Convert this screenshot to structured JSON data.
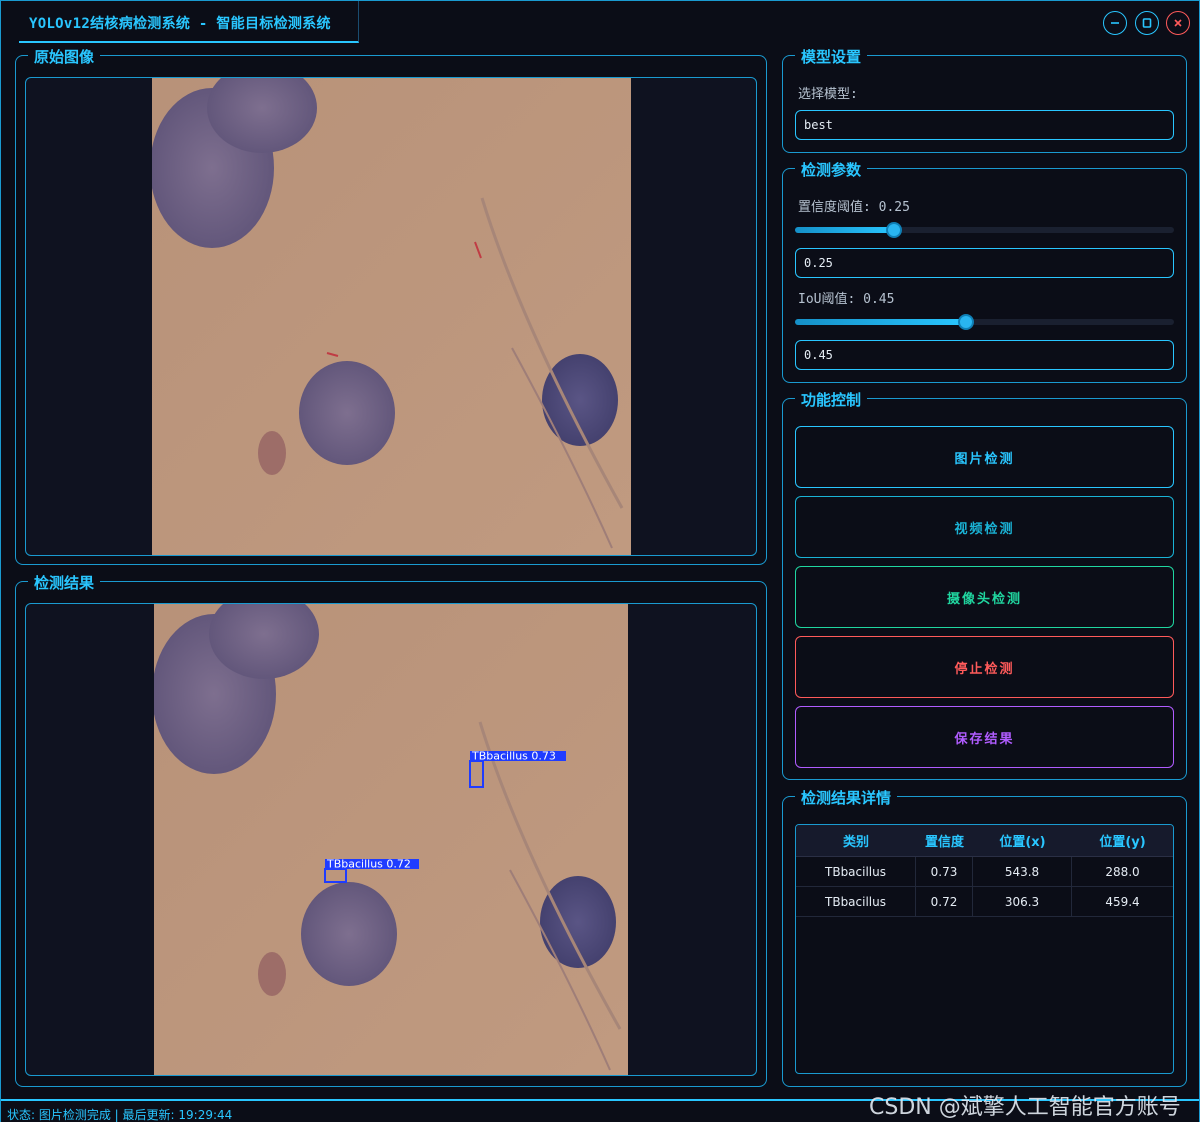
{
  "window": {
    "title": "YOLOv12结核病检测系统 - 智能目标检测系统",
    "minimize_icon": "minimize-icon",
    "maximize_icon": "maximize-icon",
    "close_icon": "close-icon"
  },
  "original_panel": {
    "title": "原始图像"
  },
  "result_panel": {
    "title": "检测结果",
    "detections": [
      {
        "label": "TBbacillus 0.73"
      },
      {
        "label": "TBbacillus 0.72"
      }
    ]
  },
  "model_settings": {
    "title": "模型设置",
    "select_label": "选择模型:",
    "selected_model": "best"
  },
  "detect_params": {
    "title": "检测参数",
    "confidence_label": "置信度阈值: 0.25",
    "confidence_value": "0.25",
    "confidence_level": 0.25,
    "iou_label": "IoU阈值: 0.45",
    "iou_value": "0.45",
    "iou_level": 0.45
  },
  "controls": {
    "title": "功能控制",
    "buttons": [
      {
        "label": "图片检测",
        "color": "#29c6ff"
      },
      {
        "label": "视频检测",
        "color": "#1ab3d6"
      },
      {
        "label": "摄像头检测",
        "color": "#20d6a0"
      },
      {
        "label": "停止检测",
        "color": "#ff5a5a"
      },
      {
        "label": "保存结果",
        "color": "#b05cff"
      }
    ]
  },
  "details": {
    "title": "检测结果详情",
    "columns": [
      "类别",
      "置信度",
      "位置(x)",
      "位置(y)"
    ],
    "rows": [
      [
        "TBbacillus",
        "0.73",
        "543.8",
        "288.0"
      ],
      [
        "TBbacillus",
        "0.72",
        "306.3",
        "459.4"
      ]
    ]
  },
  "status": {
    "text": "状态: 图片检测完成 | 最后更新: 19:29:44"
  },
  "watermark": "CSDN @斌擎人工智能官方账号",
  "colors": {
    "accent": "#29c6ff",
    "background": "#0b0d17",
    "detection_box": "#1f3cff"
  }
}
